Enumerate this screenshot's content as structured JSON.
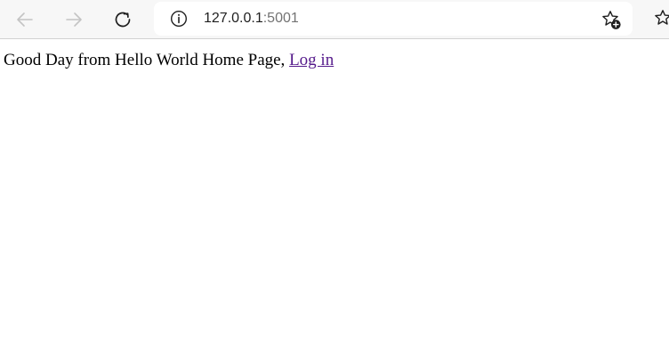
{
  "browser": {
    "back_icon": "arrow-left-icon",
    "forward_icon": "arrow-right-icon",
    "reload_icon": "refresh-icon",
    "site_info_icon": "info-icon",
    "favorite_icon": "star-plus-icon",
    "collections_icon": "star-list-icon",
    "url_host": "127.0.0.1",
    "url_port": ":5001"
  },
  "page": {
    "greeting": "Good Day from Hello World Home Page,",
    "login_link": "Log in"
  },
  "colors": {
    "link_visited": "#551a8b",
    "toolbar_bg": "#f7f7f7",
    "icon_disabled": "#c4c4c4",
    "icon_active": "#1f1f1f"
  }
}
